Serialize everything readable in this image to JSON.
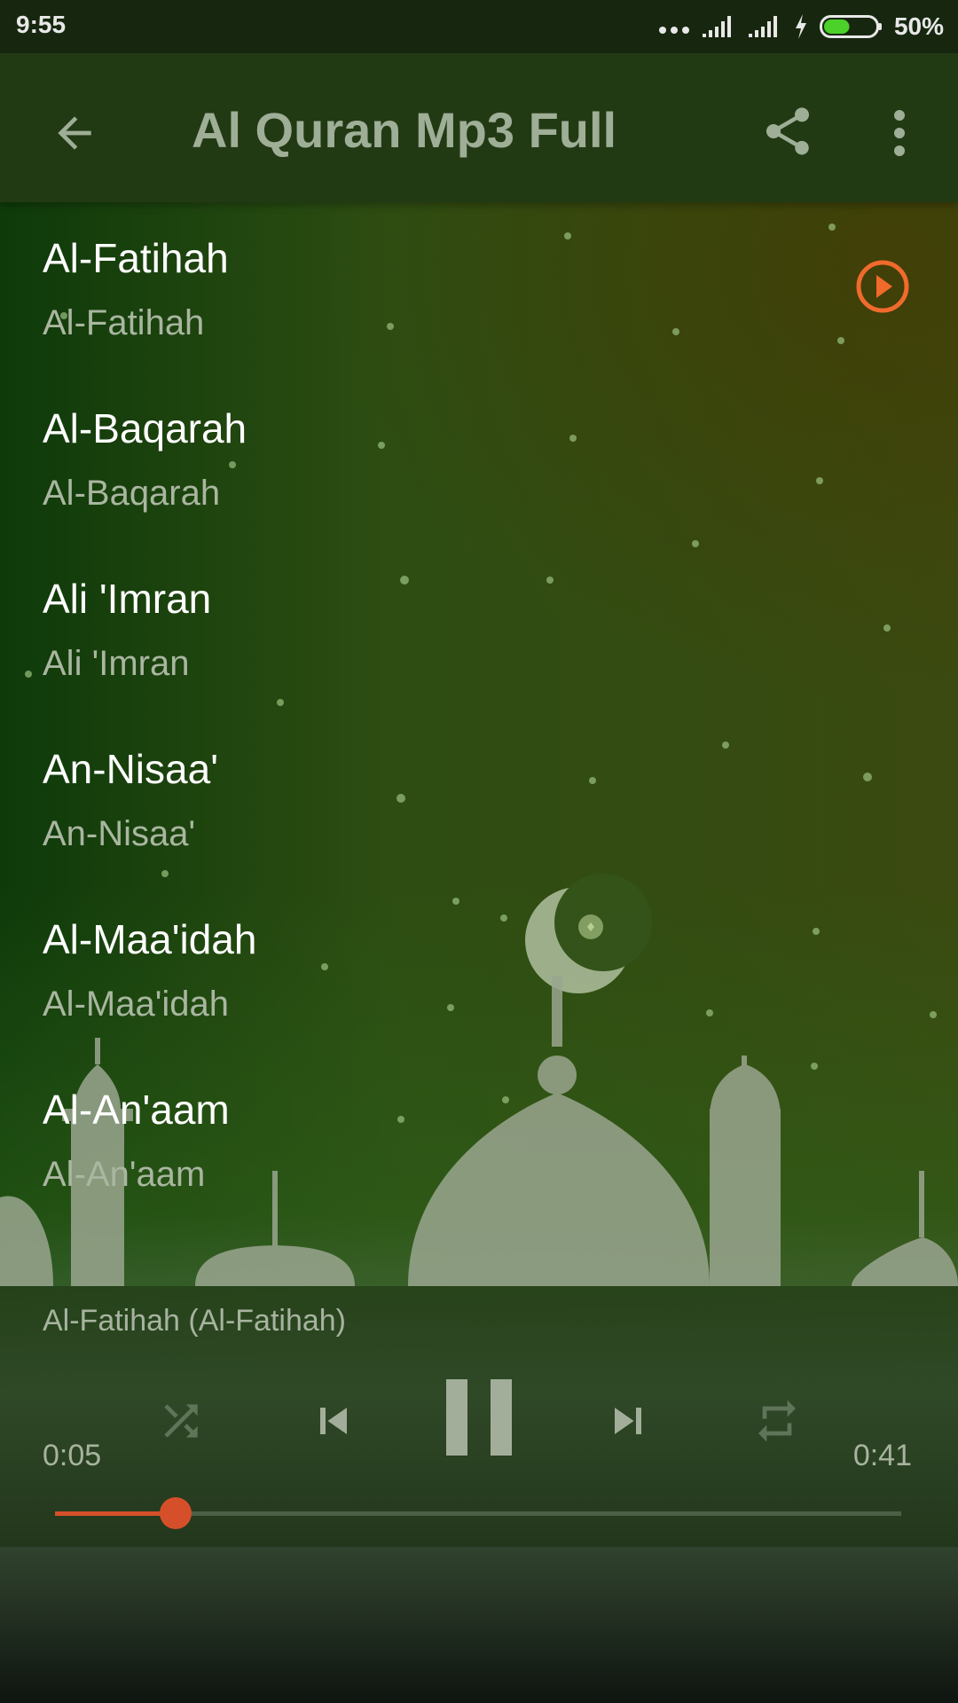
{
  "status_bar": {
    "time": "9:55",
    "battery_percent": "50%",
    "battery_level": 0.5
  },
  "app_bar": {
    "title": "Al Quran Mp3 Full",
    "back_icon": "arrow-left-icon",
    "share_icon": "share-icon",
    "menu_icon": "more-vert-icon"
  },
  "tracks": [
    {
      "title": "Al-Fatihah",
      "subtitle": "Al-Fatihah",
      "playing": true
    },
    {
      "title": "Al-Baqarah",
      "subtitle": "Al-Baqarah",
      "playing": false
    },
    {
      "title": "Ali 'Imran",
      "subtitle": "Ali 'Imran",
      "playing": false
    },
    {
      "title": "An-Nisaa'",
      "subtitle": "An-Nisaa'",
      "playing": false
    },
    {
      "title": "Al-Maa'idah",
      "subtitle": "Al-Maa'idah",
      "playing": false
    },
    {
      "title": "Al-An'aam",
      "subtitle": "Al-An'aam",
      "playing": false
    }
  ],
  "player": {
    "now_playing": "Al-Fatihah (Al-Fatihah)",
    "elapsed": "0:05",
    "total": "0:41",
    "progress": 0.143,
    "controls": [
      "shuffle-icon",
      "skip-previous-icon",
      "pause-icon",
      "skip-next-icon",
      "repeat-icon"
    ]
  },
  "colors": {
    "accent": "#d5502a",
    "playing_icon": "#f06a2c",
    "app_bar": "#223a14",
    "status_bar": "#17270f",
    "title_text": "#9fae96",
    "primary_text": "#ffffff",
    "secondary_text": "#a9b6a0"
  }
}
